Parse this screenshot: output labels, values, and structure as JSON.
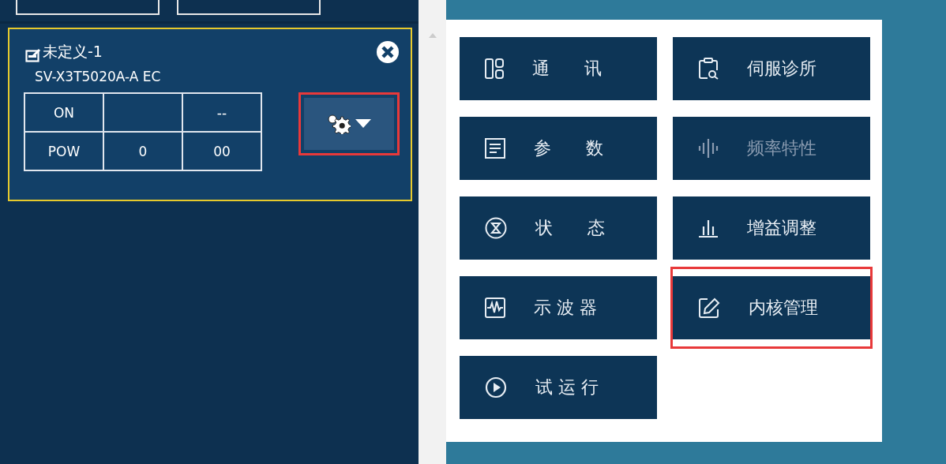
{
  "device_card": {
    "title": "未定义-1",
    "model": "SV-X3T5020A-A EC",
    "selected": true,
    "status_table": [
      {
        "column_1": "ON",
        "column_3": "--"
      },
      {
        "column_1": "POW",
        "column_2": "0",
        "column_3": "00"
      }
    ],
    "settings_button": {
      "highlighted": true
    }
  },
  "menu": {
    "items": [
      {
        "label": "通　　讯",
        "disabled": false,
        "highlighted": false
      },
      {
        "label": "伺服诊所",
        "disabled": false,
        "highlighted": false
      },
      {
        "label": "参　　数",
        "disabled": false,
        "highlighted": false
      },
      {
        "label": "频率特性",
        "disabled": true,
        "highlighted": false
      },
      {
        "label": "状　　态",
        "disabled": false,
        "highlighted": false
      },
      {
        "label": "增益调整",
        "disabled": false,
        "highlighted": false
      },
      {
        "label": "示 波 器",
        "disabled": false,
        "highlighted": false
      },
      {
        "label": "内核管理",
        "disabled": false,
        "highlighted": true
      },
      {
        "label": "试 运 行",
        "disabled": false,
        "highlighted": false
      }
    ]
  }
}
